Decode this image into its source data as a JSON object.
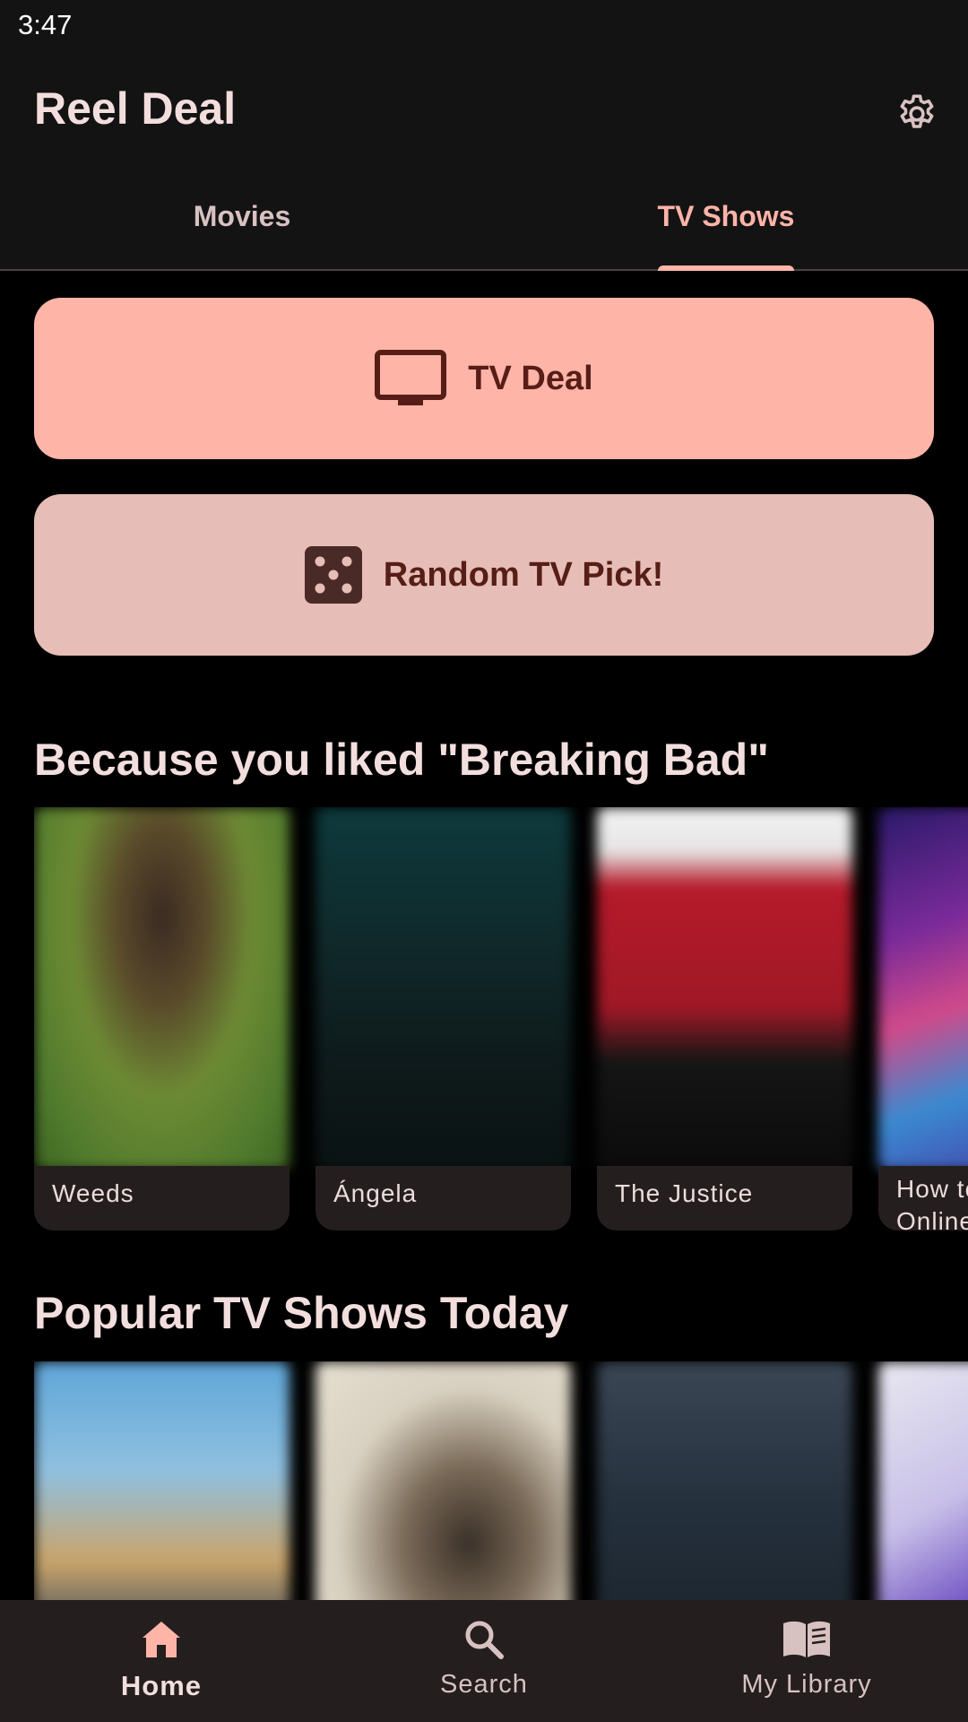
{
  "status_bar": {
    "time": "3:47"
  },
  "app_bar": {
    "title": "Reel Deal",
    "settings_icon": "gear-icon"
  },
  "tabs": [
    {
      "label": "Movies",
      "active": false
    },
    {
      "label": "TV Shows",
      "active": true
    }
  ],
  "actions": {
    "tv_deal": {
      "label": "TV Deal",
      "icon": "tv-icon"
    },
    "random_pick": {
      "label": "Random TV Pick!",
      "icon": "dice-icon"
    }
  },
  "sections": [
    {
      "title": "Because you liked \"Breaking Bad\"",
      "items": [
        {
          "title": "Weeds"
        },
        {
          "title": "Ángela"
        },
        {
          "title": "The Justice"
        },
        {
          "title": "How to Sell Drugs Online (Fast)"
        }
      ]
    },
    {
      "title": "Popular TV Shows Today",
      "items": []
    }
  ],
  "bottom_nav": [
    {
      "label": "Home",
      "icon": "home-icon",
      "active": true
    },
    {
      "label": "Search",
      "icon": "search-icon",
      "active": false
    },
    {
      "label": "My Library",
      "icon": "book-icon",
      "active": false
    }
  ],
  "colors": {
    "accent": "#ffb4a8",
    "secondary_button": "#e7bdb7",
    "on_accent": "#561e16",
    "surface": "#141314",
    "nav_surface": "#251e1f"
  }
}
